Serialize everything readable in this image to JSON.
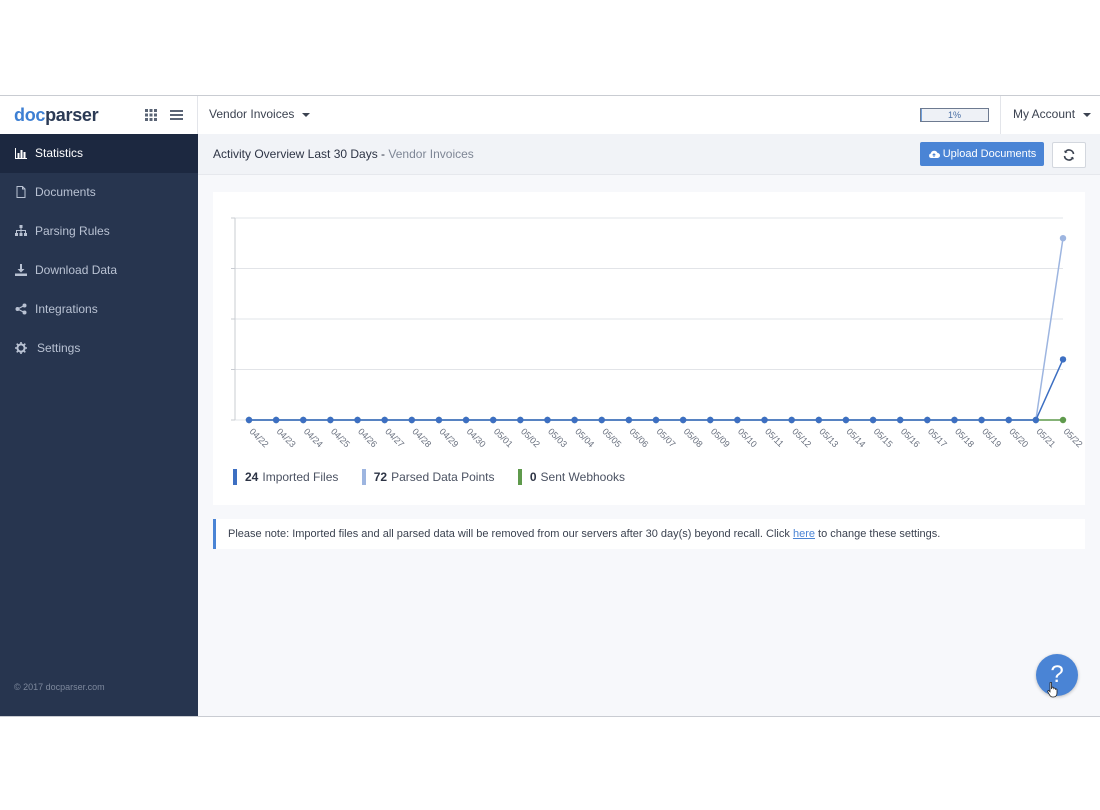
{
  "app": {
    "logo_doc": "doc",
    "logo_parser": "parser",
    "parser_name": "Vendor Invoices",
    "usage_percent": 1,
    "usage_label": "1%",
    "account_label": "My Account",
    "copyright": "© 2017 docparser.com"
  },
  "sidebar": {
    "items": [
      {
        "label": "Statistics",
        "icon": "bar-chart-icon",
        "active": true
      },
      {
        "label": "Documents",
        "icon": "file-icon",
        "active": false
      },
      {
        "label": "Parsing Rules",
        "icon": "sitemap-icon",
        "active": false
      },
      {
        "label": "Download Data",
        "icon": "download-icon",
        "active": false
      },
      {
        "label": "Integrations",
        "icon": "share-icon",
        "active": false
      },
      {
        "label": "Settings",
        "icon": "gear-icon",
        "active": false
      }
    ]
  },
  "header": {
    "title": "Activity Overview Last 30 Days -",
    "subtitle": "Vendor Invoices",
    "upload_label": "Upload Documents"
  },
  "stats": {
    "imported_count": "24",
    "imported_label": "Imported Files",
    "parsed_count": "72",
    "parsed_label": "Parsed Data Points",
    "webhooks_count": "0",
    "webhooks_label": "Sent Webhooks"
  },
  "note": {
    "before": "Please note: Imported files and all parsed data will be removed from our servers after 30 day(s) beyond recall. Click",
    "link": "here",
    "after": "to change these settings."
  },
  "colors": {
    "imported": "#3d6fc2",
    "parsed": "#9db5e0",
    "webhooks": "#5f9a4c",
    "accent": "#4a84d5",
    "sidebar": "#27354f"
  },
  "chart_data": {
    "type": "line",
    "categories": [
      "04/22",
      "04/23",
      "04/24",
      "04/25",
      "04/26",
      "04/27",
      "04/28",
      "04/29",
      "04/30",
      "05/01",
      "05/02",
      "05/03",
      "05/04",
      "05/05",
      "05/06",
      "05/07",
      "05/08",
      "05/09",
      "05/10",
      "05/11",
      "05/12",
      "05/13",
      "05/14",
      "05/15",
      "05/16",
      "05/17",
      "05/18",
      "05/19",
      "05/20",
      "05/21",
      "05/22"
    ],
    "ylim": [
      0,
      80
    ],
    "grid": true,
    "legend_placement": "bottom-left",
    "series": [
      {
        "name": "Imported Files",
        "color": "#3d6fc2",
        "values": [
          0,
          0,
          0,
          0,
          0,
          0,
          0,
          0,
          0,
          0,
          0,
          0,
          0,
          0,
          0,
          0,
          0,
          0,
          0,
          0,
          0,
          0,
          0,
          0,
          0,
          0,
          0,
          0,
          0,
          0,
          24
        ]
      },
      {
        "name": "Parsed Data Points",
        "color": "#9db5e0",
        "values": [
          0,
          0,
          0,
          0,
          0,
          0,
          0,
          0,
          0,
          0,
          0,
          0,
          0,
          0,
          0,
          0,
          0,
          0,
          0,
          0,
          0,
          0,
          0,
          0,
          0,
          0,
          0,
          0,
          0,
          0,
          72
        ]
      },
      {
        "name": "Sent Webhooks",
        "color": "#5f9a4c",
        "values": [
          0,
          0,
          0,
          0,
          0,
          0,
          0,
          0,
          0,
          0,
          0,
          0,
          0,
          0,
          0,
          0,
          0,
          0,
          0,
          0,
          0,
          0,
          0,
          0,
          0,
          0,
          0,
          0,
          0,
          0,
          0
        ]
      }
    ]
  }
}
